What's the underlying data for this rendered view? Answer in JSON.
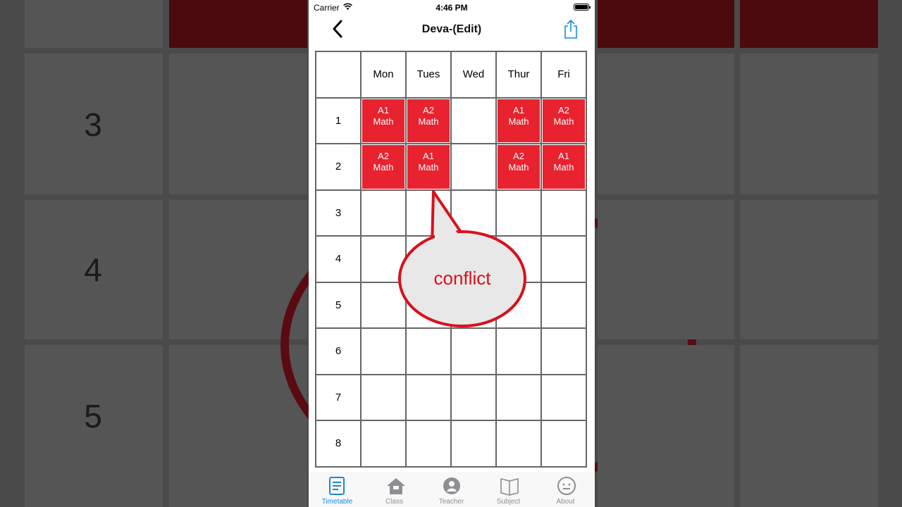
{
  "status_bar": {
    "carrier": "Carrier",
    "time": "4:46 PM"
  },
  "nav": {
    "title": "Deva-(Edit)"
  },
  "timetable": {
    "days": [
      "Mon",
      "Tues",
      "Wed",
      "Thur",
      "Fri"
    ],
    "periods": [
      "1",
      "2",
      "3",
      "4",
      "5",
      "6",
      "7",
      "8"
    ],
    "cells": {
      "p1_mon": {
        "class": "A1",
        "subject": "Math"
      },
      "p1_tues": {
        "class": "A2",
        "subject": "Math"
      },
      "p1_thur": {
        "class": "A1",
        "subject": "Math"
      },
      "p1_fri": {
        "class": "A2",
        "subject": "Math"
      },
      "p2_mon": {
        "class": "A2",
        "subject": "Math"
      },
      "p2_tues": {
        "class": "A1",
        "subject": "Math"
      },
      "p2_thur": {
        "class": "A2",
        "subject": "Math"
      },
      "p2_fri": {
        "class": "A1",
        "subject": "Math"
      }
    },
    "conflict_color": "#e8222e"
  },
  "callout": {
    "text": "conflict",
    "color": "#d8111c"
  },
  "background": {
    "periods": [
      "3",
      "4",
      "5"
    ]
  },
  "tabs": [
    {
      "label": "Timetable",
      "icon": "document-icon",
      "active": true
    },
    {
      "label": "Class",
      "icon": "house-icon",
      "active": false
    },
    {
      "label": "Teacher",
      "icon": "person-icon",
      "active": false
    },
    {
      "label": "Subject",
      "icon": "book-icon",
      "active": false
    },
    {
      "label": "About",
      "icon": "face-icon",
      "active": false
    }
  ],
  "accent_color": "#1a8ad4"
}
